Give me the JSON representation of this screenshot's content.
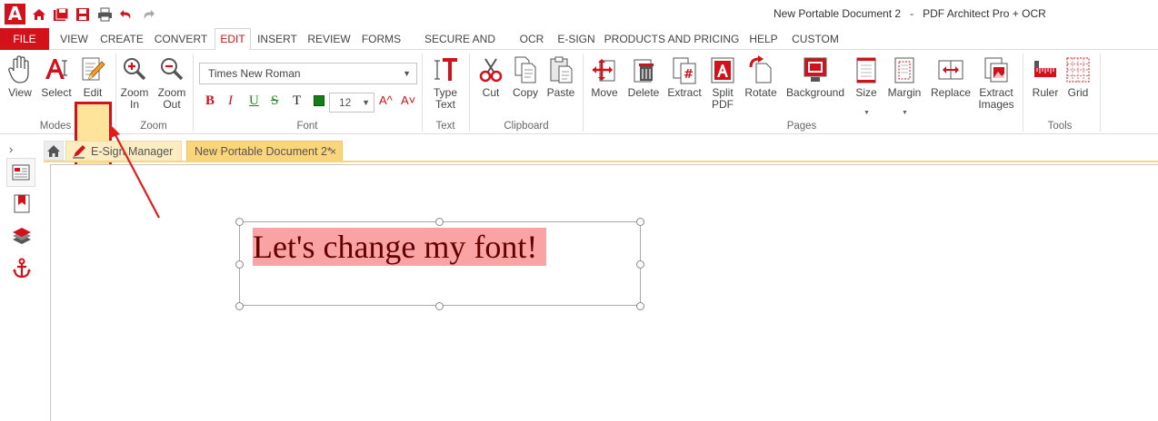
{
  "app": {
    "logo_letter": "A",
    "window_title": "New Portable Document 2   -   PDF Architect Pro + OCR",
    "accent_color": "#d2111b",
    "highlight_color": "#fde49a"
  },
  "quick_access": [
    "home-icon",
    "save-all-icon",
    "save-icon",
    "print-icon",
    "undo-icon",
    "redo-icon"
  ],
  "menu": {
    "file": "FILE",
    "tabs": [
      "VIEW",
      "CREATE",
      "CONVERT",
      "EDIT",
      "INSERT",
      "REVIEW",
      "FORMS",
      "SECURE AND SIGN",
      "OCR",
      "E-SIGN",
      "PRODUCTS AND PRICING",
      "HELP",
      "CUSTOM"
    ],
    "active": "EDIT"
  },
  "ribbon": {
    "modes": {
      "label": "Modes",
      "view": "View",
      "select": "Select",
      "edit": "Edit"
    },
    "zoom": {
      "label": "Zoom",
      "zoom_in": "Zoom In",
      "zoom_out": "Zoom Out"
    },
    "font": {
      "label": "Font",
      "family": "Times New Roman",
      "size": "12",
      "bold": "B",
      "italic": "I",
      "underline": "U",
      "strike": "S",
      "text_color": "T",
      "grow": "A^",
      "shrink": "A˅"
    },
    "text": {
      "label": "Text",
      "type_text": "Type Text"
    },
    "clipboard": {
      "label": "Clipboard",
      "cut": "Cut",
      "copy": "Copy",
      "paste": "Paste"
    },
    "pages": {
      "label": "Pages",
      "move": "Move",
      "delete": "Delete",
      "extract": "Extract",
      "split": "Split PDF",
      "rotate": "Rotate",
      "background": "Background",
      "size": "Size",
      "margin": "Margin",
      "replace": "Replace",
      "extract_images": "Extract Images"
    },
    "tools": {
      "label": "Tools",
      "ruler": "Ruler",
      "grid": "Grid"
    }
  },
  "doc_tabs": [
    {
      "label": "E-Sign Manager"
    },
    {
      "label": "New Portable Document 2*",
      "close": "×"
    }
  ],
  "document": {
    "text": "Let's change my font!",
    "highlight_color": "#f9a3a5"
  }
}
